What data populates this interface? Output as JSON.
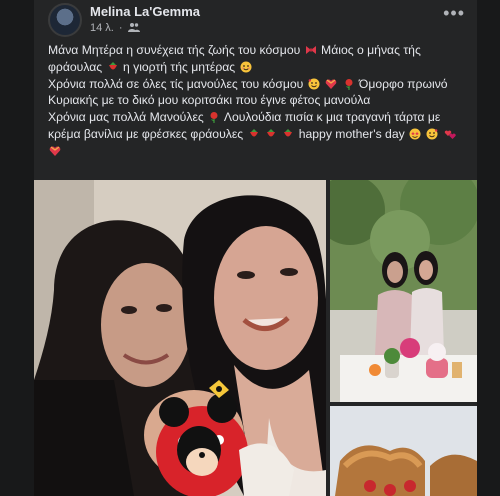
{
  "post": {
    "author": "Melina La'Gemma",
    "time": "14 λ.",
    "separator": "·",
    "audience_icon": "people-icon",
    "more_icon": "more-options-icon",
    "text_lines": {
      "p1_a": "Μάνα Μητέρα η συνέχεια τής ζωής του κόσμου",
      "p1_b": "Μάιος ο μήνας τής φράουλας",
      "p1_c": "η γιορτή τής μητέρας",
      "p2_a": "Χρόνια πολλά σε όλες τίς μανούλες του κόσμου",
      "p2_b": "Όμορφο πρωινό Κυριακής με το δικό μου κοριτσάκι που έγινε φέτος μανούλα",
      "p3_a": "Χρόνια μας πολλά Μανούλες",
      "p3_b": "Λουλούδια πισία κ μια τραγανή τάρτα με κρέμα βανίλια με φρέσκες φράουλες",
      "p3_c": "happy mother's day"
    }
  },
  "colors": {
    "background": "#18191a",
    "card": "#242526",
    "text_primary": "#e4e6eb",
    "text_secondary": "#b0b3b8"
  },
  "photos": {
    "main": "photo-mother-daughter-baby",
    "garden": "photo-garden-table-flowers",
    "food": "photo-tart-strawberries"
  }
}
